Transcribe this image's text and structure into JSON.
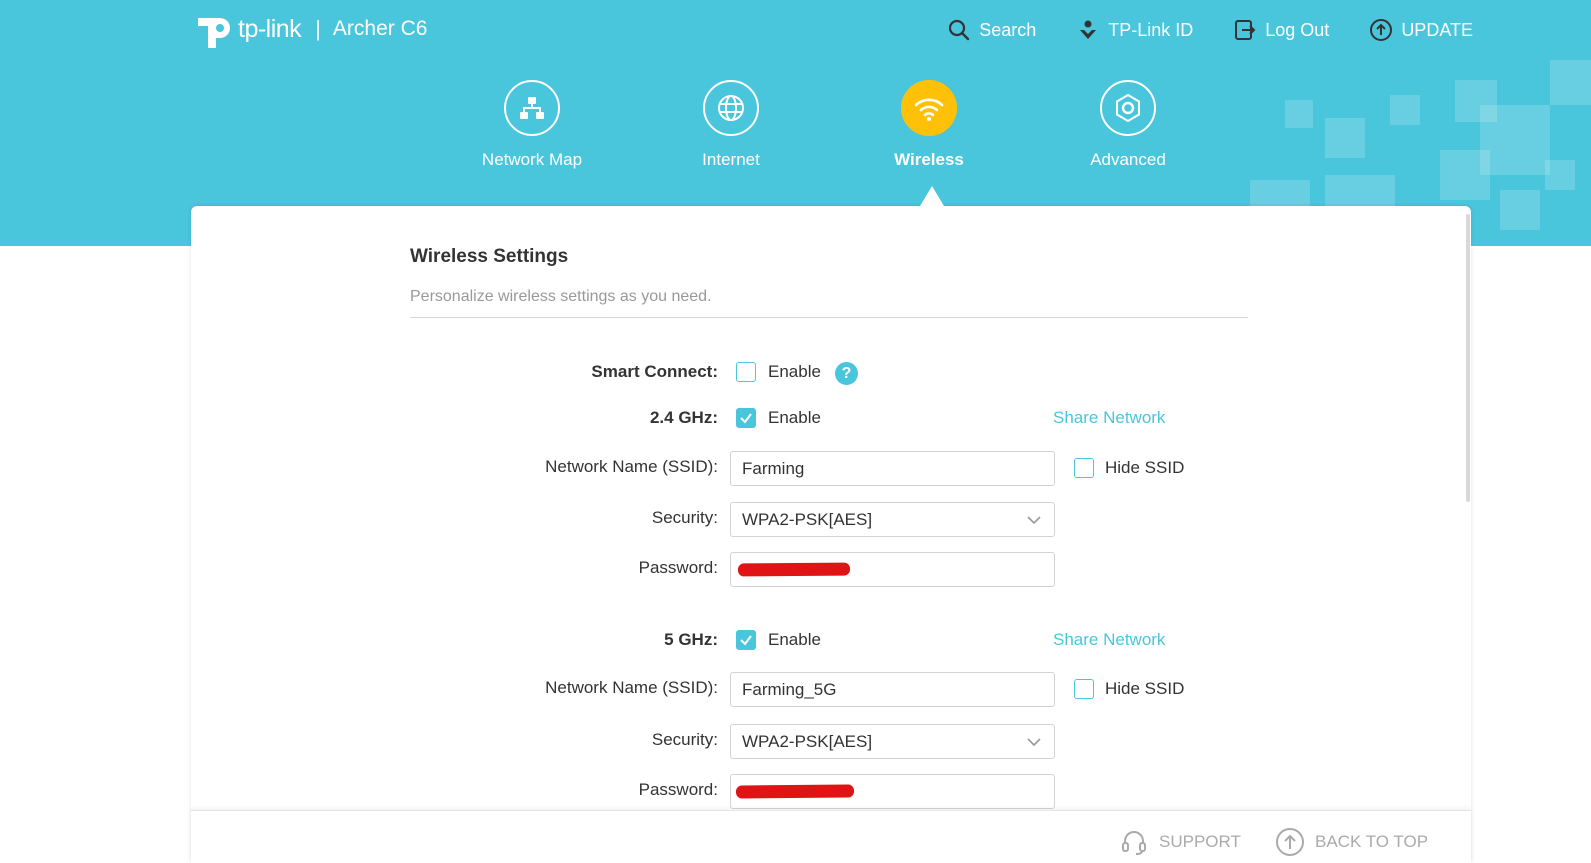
{
  "app": {
    "brand": "tp-link",
    "separator": "|",
    "model": "Archer C6"
  },
  "topnav": [
    {
      "icon": "search-icon",
      "label": "Search"
    },
    {
      "icon": "tplink-id-icon",
      "label": "TP-Link ID"
    },
    {
      "icon": "logout-icon",
      "label": "Log Out"
    },
    {
      "icon": "update-icon",
      "label": "UPDATE"
    }
  ],
  "mainnav": [
    {
      "icon": "network-map-icon",
      "label": "Network Map",
      "active": false
    },
    {
      "icon": "internet-globe-icon",
      "label": "Internet",
      "active": false
    },
    {
      "icon": "wifi-icon",
      "label": "Wireless",
      "active": true
    },
    {
      "icon": "gear-icon",
      "label": "Advanced",
      "active": false
    }
  ],
  "section": {
    "title": "Wireless Settings",
    "subtitle": "Personalize wireless settings as you need."
  },
  "smart_connect": {
    "label": "Smart Connect:",
    "enable_label": "Enable",
    "checked": false,
    "help": "?"
  },
  "band_24": {
    "label": "2.4 GHz:",
    "enable_label": "Enable",
    "enabled": true,
    "share_label": "Share Network",
    "ssid_label": "Network Name (SSID):",
    "ssid": "Farming",
    "hide_ssid_label": "Hide SSID",
    "hide_ssid": false,
    "security_label": "Security:",
    "security": "WPA2-PSK[AES]",
    "password_label": "Password:"
  },
  "band_5": {
    "label": "5 GHz:",
    "enable_label": "Enable",
    "enabled": true,
    "share_label": "Share Network",
    "ssid_label": "Network Name (SSID):",
    "ssid": "Farming_5G",
    "hide_ssid_label": "Hide SSID",
    "hide_ssid": false,
    "security_label": "Security:",
    "security": "WPA2-PSK[AES]",
    "password_label": "Password:"
  },
  "footer": {
    "support_label": "SUPPORT",
    "back_to_top_label": "BACK TO TOP"
  },
  "colors": {
    "brand": "#4ac6dc",
    "active_nav": "#ffc107",
    "redaction": "#e01414"
  }
}
